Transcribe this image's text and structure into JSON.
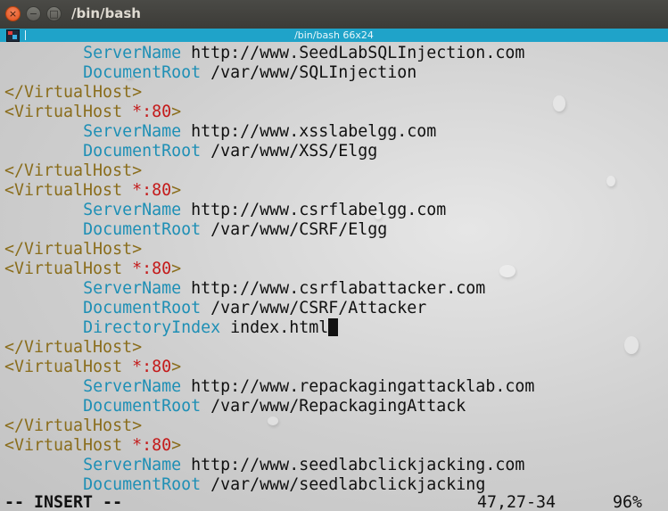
{
  "window": {
    "title": "/bin/bash",
    "tabstrip_label": "/bin/bash 66x24",
    "close_glyph": "×",
    "min_glyph": "−",
    "max_glyph": "□"
  },
  "colors": {
    "titlebar": "#3c3b37",
    "tabstrip": "#1fa3c9",
    "tag": "#8a6d1c",
    "port": "#c41a1a",
    "directive": "#1e8fb5"
  },
  "lines": [
    {
      "indent": "        ",
      "directive": "ServerName",
      "value": " http://www.SeedLabSQLInjection.com"
    },
    {
      "indent": "        ",
      "directive": "DocumentRoot",
      "value": " /var/www/SQLInjection"
    },
    {
      "close_tag": "</VirtualHost>"
    },
    {
      "open_tag_start": "<VirtualHost ",
      "port": "*:80",
      "open_tag_end": ">"
    },
    {
      "indent": "        ",
      "directive": "ServerName",
      "value": " http://www.xsslabelgg.com"
    },
    {
      "indent": "        ",
      "directive": "DocumentRoot",
      "value": " /var/www/XSS/Elgg"
    },
    {
      "close_tag": "</VirtualHost>"
    },
    {
      "open_tag_start": "<VirtualHost ",
      "port": "*:80",
      "open_tag_end": ">"
    },
    {
      "indent": "        ",
      "directive": "ServerName",
      "value": " http://www.csrflabelgg.com"
    },
    {
      "indent": "        ",
      "directive": "DocumentRoot",
      "value": " /var/www/CSRF/Elgg"
    },
    {
      "close_tag": "</VirtualHost>"
    },
    {
      "open_tag_start": "<VirtualHost ",
      "port": "*:80",
      "open_tag_end": ">"
    },
    {
      "indent": "        ",
      "directive": "ServerName",
      "value": " http://www.csrflabattacker.com"
    },
    {
      "indent": "        ",
      "directive": "DocumentRoot",
      "value": " /var/www/CSRF/Attacker"
    },
    {
      "indent": "        ",
      "directive": "DirectoryIndex",
      "value": " index.html",
      "cursor": true
    },
    {
      "close_tag": "</VirtualHost>"
    },
    {
      "open_tag_start": "<VirtualHost ",
      "port": "*:80",
      "open_tag_end": ">"
    },
    {
      "indent": "        ",
      "directive": "ServerName",
      "value": " http://www.repackagingattacklab.com"
    },
    {
      "indent": "        ",
      "directive": "DocumentRoot",
      "value": " /var/www/RepackagingAttack"
    },
    {
      "close_tag": "</VirtualHost>"
    },
    {
      "open_tag_start": "<VirtualHost ",
      "port": "*:80",
      "open_tag_end": ">"
    },
    {
      "indent": "        ",
      "directive": "ServerName",
      "value": " http://www.seedlabclickjacking.com"
    },
    {
      "indent": "        ",
      "directive": "DocumentRoot",
      "value": " /var/www/seedlabclickjacking"
    }
  ],
  "statusbar": {
    "mode": "-- INSERT --",
    "position": "47,27-34",
    "percent": "96%"
  }
}
